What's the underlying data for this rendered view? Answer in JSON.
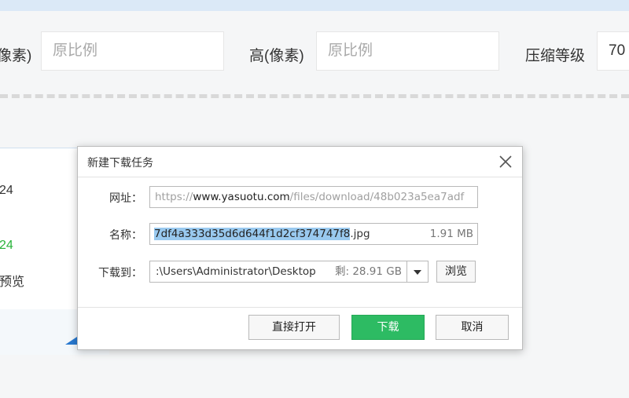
{
  "settings": {
    "width_label": "像素)",
    "width_placeholder": "原比例",
    "height_label": "高(像素)",
    "height_placeholder": "原比例",
    "compress_label": "压缩等级",
    "compress_value": "70"
  },
  "card": {
    "line1": "24",
    "line2": "24",
    "line3": "预览",
    "accent_color": "#28b33a"
  },
  "dialog": {
    "title": "新建下载任务",
    "url_label": "网址：",
    "url_prefix": "https://",
    "url_host": "www.yasuotu.com",
    "url_path": "/files/download/48b023a5ea7adf",
    "name_label": "名称：",
    "name_selected": "7df4a333d35d6d644f1d2cf374747f8",
    "name_ext": ".jpg",
    "file_size": "1.91 MB",
    "save_label": "下载到：",
    "save_path": ":\\Users\\Administrator\\Desktop",
    "free_space": "剩: 28.91 GB",
    "browse_label": "浏览",
    "open_label": "直接打开",
    "download_label": "下载",
    "cancel_label": "取消"
  },
  "colors": {
    "primary_button": "#2dbb63",
    "selection": "#99c9ef"
  }
}
